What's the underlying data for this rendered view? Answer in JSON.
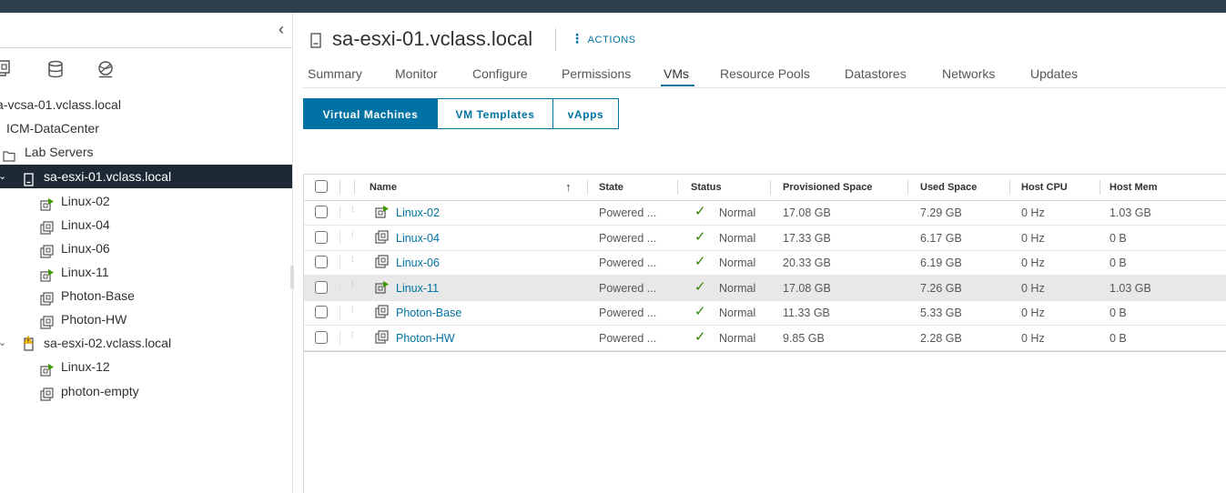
{
  "navigator": {
    "collapse_glyph": "‹",
    "nav_icons": [
      "hosts-and-clusters-icon",
      "vms-and-templates-icon",
      "storage-icon",
      "networking-icon"
    ],
    "tree": [
      {
        "label": "a-vcsa-01.vclass.local",
        "icon": "none",
        "level": 0
      },
      {
        "label": "ICM-DataCenter",
        "icon": "none",
        "level": 0
      },
      {
        "label": "Lab Servers",
        "icon": "folder-icon",
        "level": 1
      },
      {
        "label": "sa-esxi-01.vclass.local",
        "icon": "host-icon",
        "level": 2,
        "selected": true
      },
      {
        "label": "Linux-02",
        "icon": "vm-running-icon",
        "level": 3
      },
      {
        "label": "Linux-04",
        "icon": "vm-icon",
        "level": 3
      },
      {
        "label": "Linux-06",
        "icon": "vm-icon",
        "level": 3
      },
      {
        "label": "Linux-11",
        "icon": "vm-running-icon",
        "level": 3
      },
      {
        "label": "Photon-Base",
        "icon": "vm-icon",
        "level": 3
      },
      {
        "label": "Photon-HW",
        "icon": "vm-icon",
        "level": 3
      },
      {
        "label": "sa-esxi-02.vclass.local",
        "icon": "host-warning-icon",
        "level": 2
      },
      {
        "label": "Linux-12",
        "icon": "vm-running-icon",
        "level": 3
      },
      {
        "label": "photon-empty",
        "icon": "vm-icon",
        "level": 3
      }
    ]
  },
  "header": {
    "title": "sa-esxi-01.vclass.local",
    "actions_label": "ACTIONS",
    "actions_glyph": "⋮"
  },
  "tabs": [
    "Summary",
    "Monitor",
    "Configure",
    "Permissions",
    "VMs",
    "Resource Pools",
    "Datastores",
    "Networks",
    "Updates"
  ],
  "active_tab": "VMs",
  "segments": [
    {
      "label": "Virtual Machines",
      "active": true
    },
    {
      "label": "VM Templates",
      "active": false
    },
    {
      "label": "vApps",
      "active": false
    }
  ],
  "grid": {
    "sort_glyph": "↑",
    "columns": [
      "Name",
      "State",
      "Status",
      "Provisioned Space",
      "Used Space",
      "Host CPU",
      "Host Mem"
    ],
    "rows": [
      {
        "name": "Linux-02",
        "icon": "vm-running-icon",
        "state": "Powered ...",
        "status": "Normal",
        "provisioned": "17.08 GB",
        "used": "7.29 GB",
        "cpu": "0 Hz",
        "mem": "1.03 GB"
      },
      {
        "name": "Linux-04",
        "icon": "vm-icon",
        "state": "Powered ...",
        "status": "Normal",
        "provisioned": "17.33 GB",
        "used": "6.17 GB",
        "cpu": "0 Hz",
        "mem": "0 B"
      },
      {
        "name": "Linux-06",
        "icon": "vm-icon",
        "state": "Powered ...",
        "status": "Normal",
        "provisioned": "20.33 GB",
        "used": "6.19 GB",
        "cpu": "0 Hz",
        "mem": "0 B"
      },
      {
        "name": "Linux-11",
        "icon": "vm-running-icon",
        "state": "Powered ...",
        "status": "Normal",
        "provisioned": "17.08 GB",
        "used": "7.26 GB",
        "cpu": "0 Hz",
        "mem": "1.03 GB",
        "highlighted": true
      },
      {
        "name": "Photon-Base",
        "icon": "vm-icon",
        "state": "Powered ...",
        "status": "Normal",
        "provisioned": "11.33 GB",
        "used": "5.33 GB",
        "cpu": "0 Hz",
        "mem": "0 B"
      },
      {
        "name": "Photon-HW",
        "icon": "vm-icon",
        "state": "Powered ...",
        "status": "Normal",
        "provisioned": "9.85 GB",
        "used": "2.28 GB",
        "cpu": "0 Hz",
        "mem": "0 B"
      }
    ]
  },
  "colors": {
    "accent": "#0072a3",
    "topbar": "#2f3e4e",
    "selected_tree": "#1d2a35",
    "status_ok": "#318700"
  }
}
